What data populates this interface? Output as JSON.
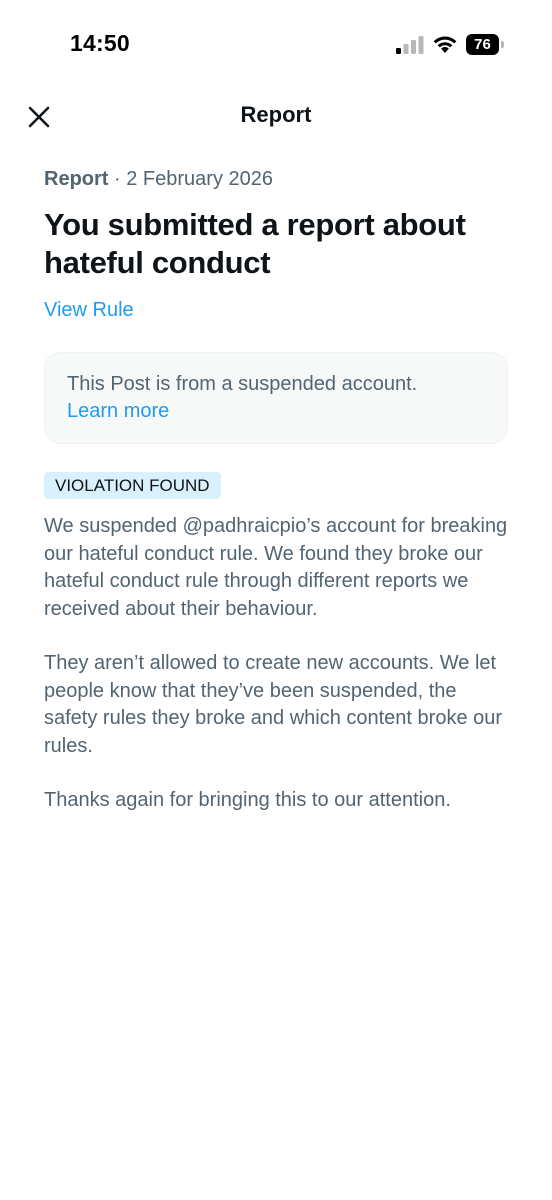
{
  "status_bar": {
    "time": "14:50",
    "battery_level": "76"
  },
  "header": {
    "title": "Report"
  },
  "report": {
    "meta_label": "Report",
    "meta_separator": " · ",
    "date": "2 February 2026",
    "headline": "You submitted a report about hateful conduct",
    "view_rule_link": "View Rule"
  },
  "notice": {
    "text": "This Post is from a suspended account.",
    "learn_more_link": "Learn more"
  },
  "badge": {
    "label": "VIOLATION FOUND"
  },
  "body": {
    "paragraph_1": "We suspended @padhraicpio’s account for breaking our hateful conduct rule. We found they broke our hateful conduct rule through different reports we received about their behaviour.",
    "paragraph_2": "They aren’t allowed to create new accounts. We let people know that they’ve been suspended, the safety rules they broke and which content broke our rules.",
    "paragraph_3": "Thanks again for bringing this to our attention."
  },
  "colors": {
    "link": "#1d9bf0",
    "secondary_text": "#536471",
    "badge_bg": "#d9f1fc"
  }
}
